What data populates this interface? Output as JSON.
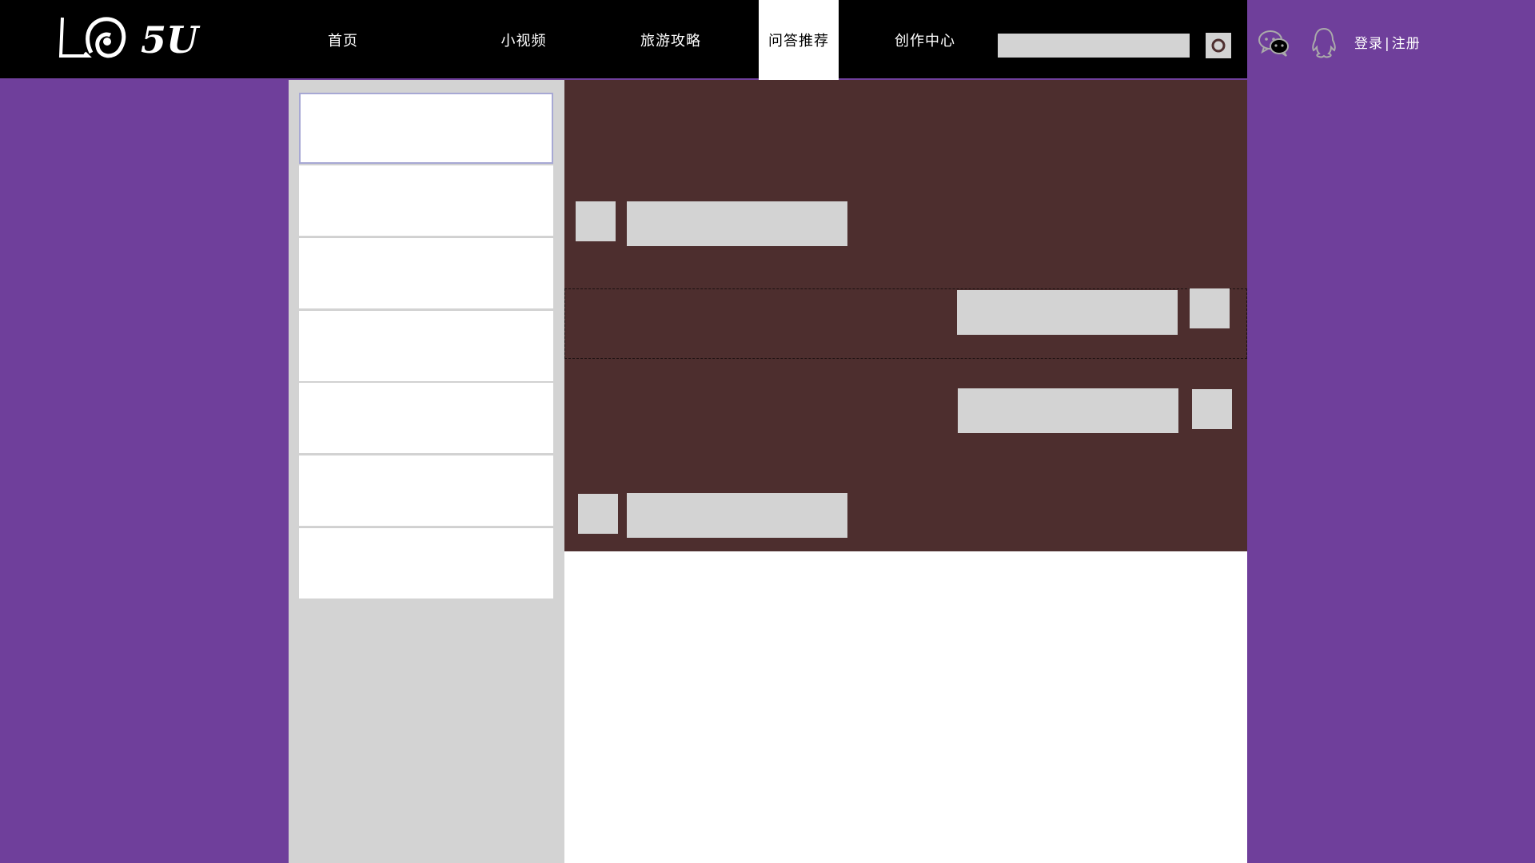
{
  "brand": {
    "logo_text": "5U"
  },
  "nav": [
    {
      "label": "首页",
      "active": false
    },
    {
      "label": "小视频",
      "active": false
    },
    {
      "label": "旅游攻略",
      "active": false
    },
    {
      "label": "问答推荐",
      "active": true
    },
    {
      "label": "创作中心",
      "active": false
    }
  ],
  "search": {
    "value": "",
    "placeholder": ""
  },
  "header_icons": [
    "wechat-icon",
    "qq-icon",
    "search-icon"
  ],
  "auth": {
    "login": "登录",
    "separator": "|",
    "register": "注册"
  },
  "sidebar": {
    "item_count": 7
  },
  "colors": {
    "page_bg": "#6f3f9b",
    "header_bg": "#000000",
    "chat_bg": "#4d2e2e",
    "placeholder_block": "#d3d3d3",
    "sidebar_bg": "#d3d3d3"
  }
}
